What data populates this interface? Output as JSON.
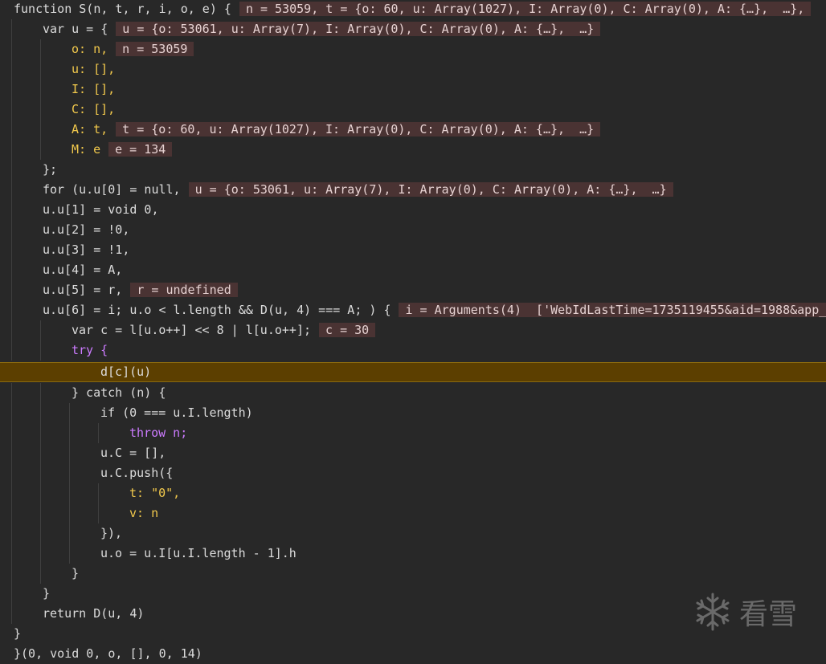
{
  "editor": {
    "lines": [
      "function S(n, t, r, i, o, e) {",
      "var u = {",
      "o: n,",
      "u: [],",
      "I: [],",
      "C: [],",
      "A: t,",
      "M: e",
      "};",
      "for (u.u[0] = null,",
      "u.u[1] = void 0,",
      "u.u[2] = !0,",
      "u.u[3] = !1,",
      "u.u[4] = A,",
      "u.u[5] = r,",
      "u.u[6] = i; u.o < l.length && D(u, 4) === A; ) {",
      "var c = l[u.o++] << 8 | l[u.o++];",
      "try {",
      "d[c](u)",
      "} catch (n) {",
      "if (0 === u.I.length)",
      "throw n;",
      "u.C = [],",
      "u.C.push({",
      "t: \"0\",",
      "v: n",
      "}),",
      "u.o = u.I[u.I.length - 1].h",
      "}",
      "}",
      "return D(u, 4)",
      "}",
      "}(0, void 0, o, [], 0, 14)"
    ],
    "inline_values": {
      "line1": "n = 53059, t = {o: 60, u: Array(1027), I: Array(0), C: Array(0), A: {…},  …},",
      "line2": "u = {o: 53061, u: Array(7), I: Array(0), C: Array(0), A: {…},  …}",
      "line3": "n = 53059",
      "line7": "t = {o: 60, u: Array(1027), I: Array(0), C: Array(0), A: {…},  …}",
      "line8": "e = 134",
      "line10": "u = {o: 53061, u: Array(7), I: Array(0), C: Array(0), A: {…},  …}",
      "line15": "r = undefined",
      "line16": "i = Arguments(4)  ['WebIdLastTime=1735119455&aid=1988&app_",
      "line17": "c = 30"
    },
    "current_line_index": 18
  },
  "watermark": {
    "icon": "snowflake-icon",
    "text": "看雪"
  },
  "colors": {
    "background": "#282828",
    "current_line": "#5c3f00",
    "inline_value_bg": "#4a3333",
    "keyword": "#cc7bff",
    "property": "#f2c94c"
  }
}
